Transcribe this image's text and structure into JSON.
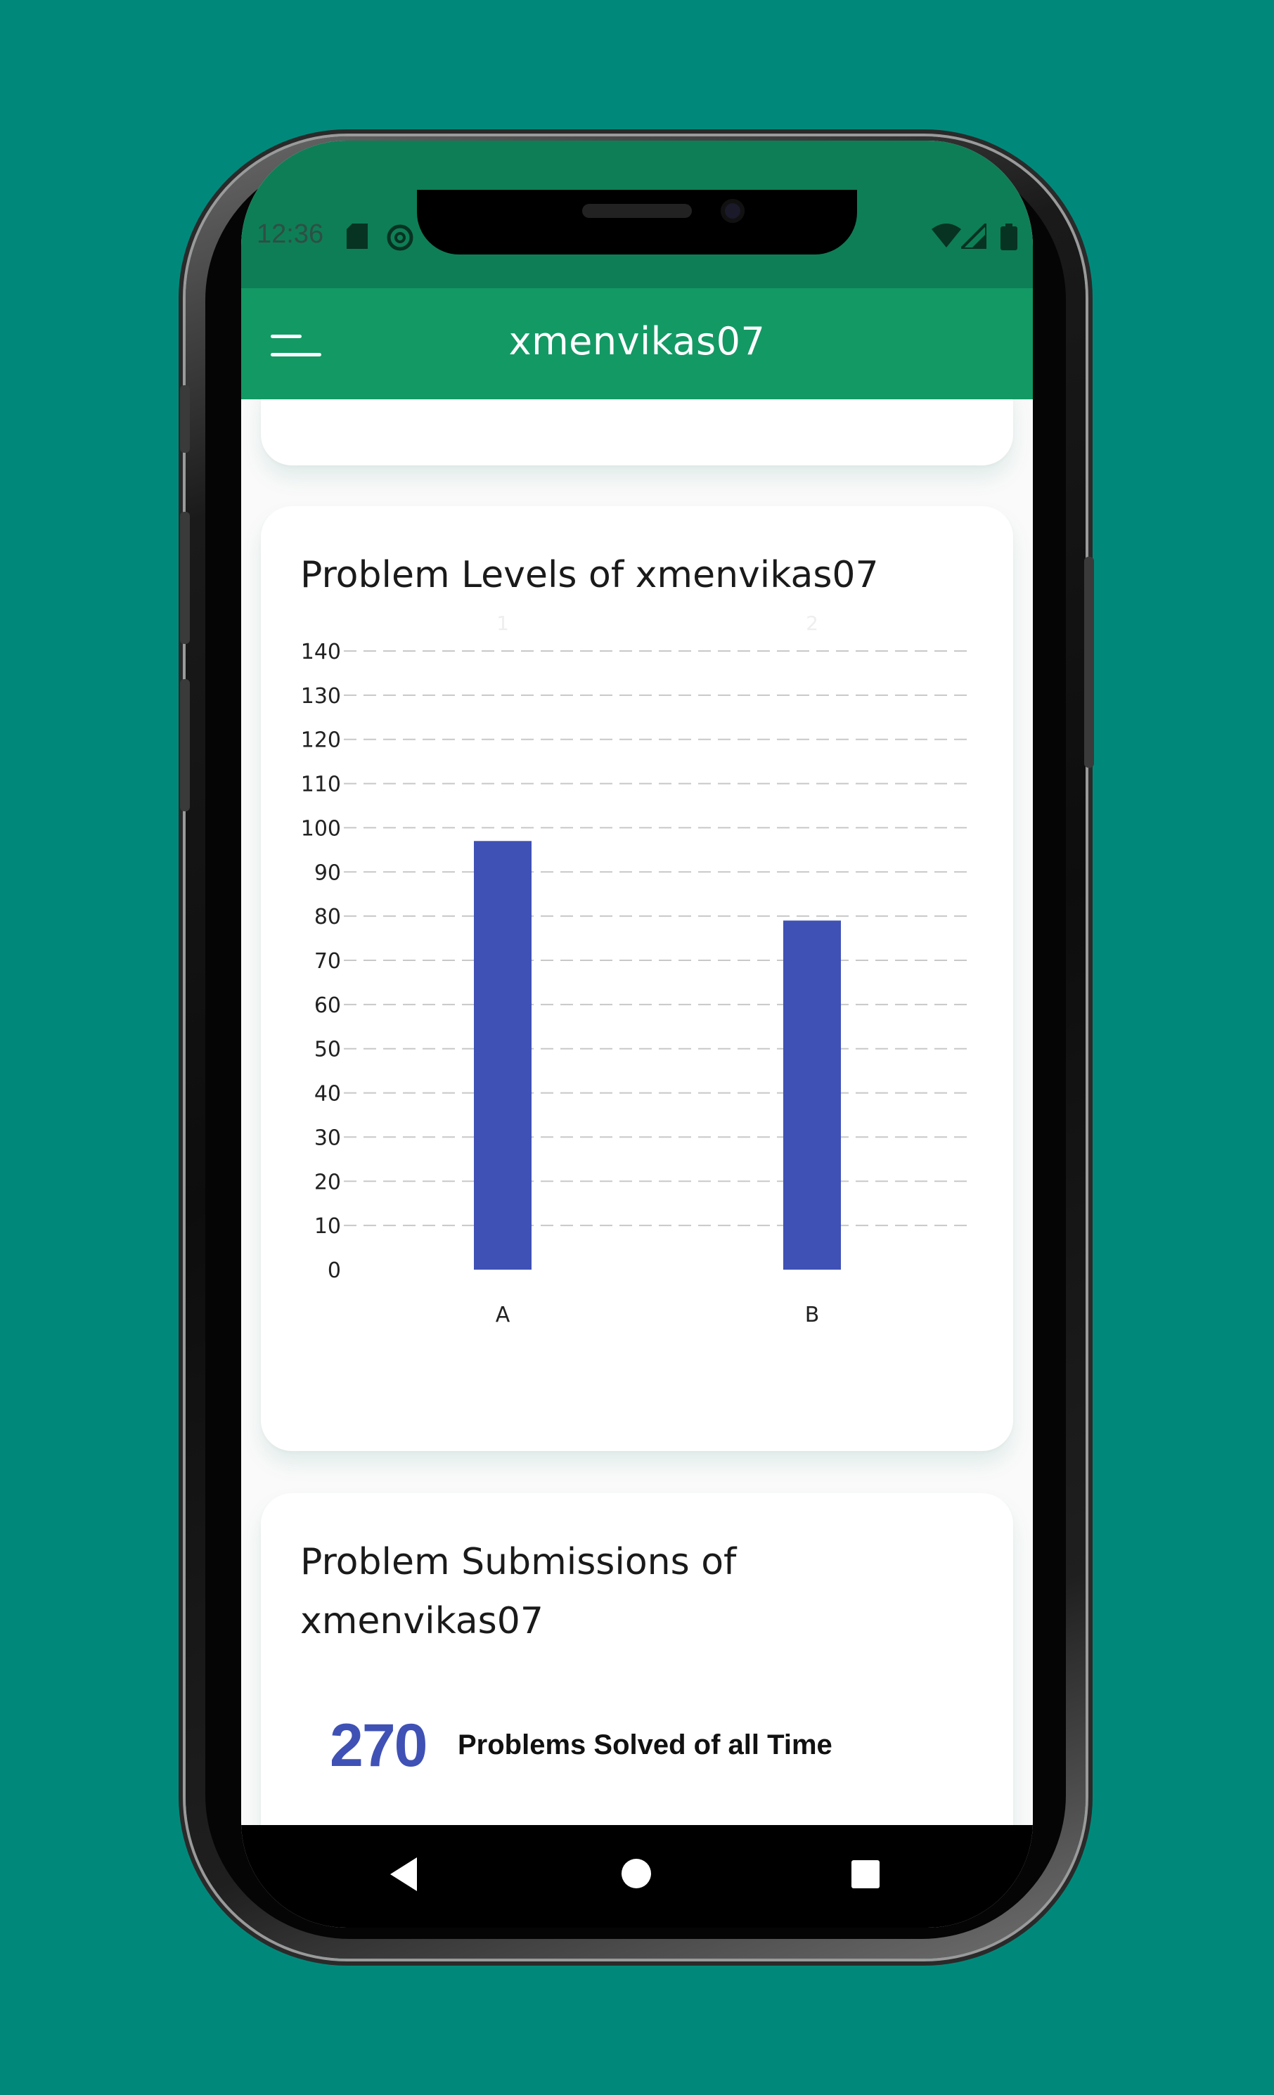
{
  "status_bar": {
    "time": "12:36",
    "icons": [
      "sd-card-icon",
      "at-sign-icon",
      "wifi-icon",
      "signal-icon",
      "battery-icon"
    ]
  },
  "app_bar": {
    "title": "xmenvikas07",
    "menu_icon": "menu-icon"
  },
  "levels_card": {
    "title": "Problem Levels of xmenvikas07"
  },
  "chart_data": {
    "type": "bar",
    "categories": [
      "A",
      "B"
    ],
    "values": [
      97,
      79
    ],
    "top_labels": [
      "1",
      "2"
    ],
    "yticks": [
      0,
      10,
      20,
      30,
      40,
      50,
      60,
      70,
      80,
      90,
      100,
      110,
      120,
      130,
      140
    ],
    "ylim": [
      0,
      140
    ],
    "grid": "dashed-horizontal",
    "bar_color": "#3F51B5"
  },
  "submissions_card": {
    "title": "Problem Submissions of xmenvikas07",
    "count": "270",
    "count_label": "Problems Solved of all Time"
  },
  "nav_bar": {
    "icons": [
      "back-icon",
      "home-icon",
      "recents-icon"
    ]
  },
  "colors": {
    "background": "#00897B",
    "app_bar": "#139964",
    "status_bar": "#0E7E57",
    "accent": "#3F51B5"
  }
}
